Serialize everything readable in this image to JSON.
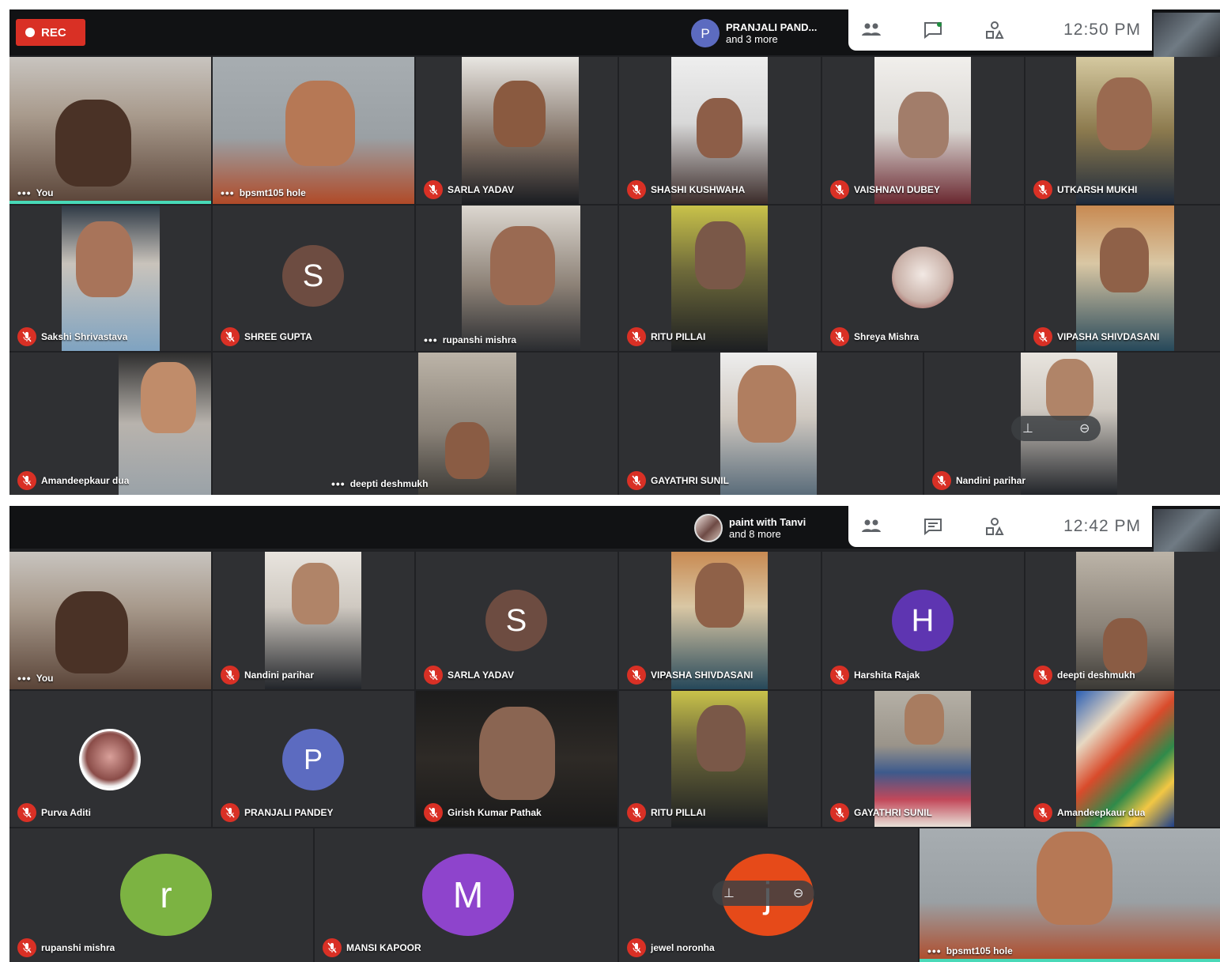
{
  "colors": {
    "background": "#202124",
    "topbar": "#111214",
    "tile": "#3c4043",
    "mic_off": "#d93025",
    "rec": "#d93025",
    "active_speaker": "#48d9b8"
  },
  "screenshot_top": {
    "rec_label": "REC",
    "presenting": {
      "avatar_letter": "P",
      "name": "PRANJALI PAND...",
      "more": "and 3 more"
    },
    "panel": {
      "people_count_icon": "people-icon",
      "chat_icon": "chat-icon",
      "activities_icon": "activities-icon",
      "time": "12:50 PM"
    },
    "tiles": [
      {
        "name": "You",
        "status": "more-options"
      },
      {
        "name": "bpsmt105 hole",
        "status": "more-options"
      },
      {
        "name": "SARLA YADAV",
        "status": "muted"
      },
      {
        "name": "SHASHI KUSHWAHA",
        "status": "muted"
      },
      {
        "name": "VAISHNAVI DUBEY",
        "status": "muted"
      },
      {
        "name": "UTKARSH MUKHI",
        "status": "muted"
      },
      {
        "name": "Sakshi Shrivastava",
        "status": "muted"
      },
      {
        "name": "SHREE GUPTA",
        "status": "muted",
        "avatar_letter": "S"
      },
      {
        "name": "rupanshi mishra",
        "status": "more-options"
      },
      {
        "name": "RITU PILLAI",
        "status": "muted"
      },
      {
        "name": "Shreya Mishra",
        "status": "muted"
      },
      {
        "name": "VIPASHA SHIVDASANI",
        "status": "muted"
      },
      {
        "name": "Amandeepkaur dua",
        "status": "muted"
      },
      {
        "name": "deepti deshmukh",
        "status": "more-options"
      },
      {
        "name": "GAYATHRI SUNIL",
        "status": "muted"
      },
      {
        "name": "Nandini parihar",
        "status": "muted"
      }
    ]
  },
  "screenshot_bottom": {
    "presenting": {
      "name": "paint with Tanvi",
      "more": "and 8 more"
    },
    "panel": {
      "time": "12:42 PM"
    },
    "tiles": [
      {
        "name": "You",
        "status": "more-options"
      },
      {
        "name": "Nandini parihar",
        "status": "muted"
      },
      {
        "name": "SARLA YADAV",
        "status": "muted",
        "avatar_letter": "S"
      },
      {
        "name": "VIPASHA SHIVDASANI",
        "status": "muted"
      },
      {
        "name": "Harshita Rajak",
        "status": "muted",
        "avatar_letter": "H"
      },
      {
        "name": "deepti deshmukh",
        "status": "muted"
      },
      {
        "name": "Purva Aditi",
        "status": "muted"
      },
      {
        "name": "PRANJALI PANDEY",
        "status": "muted",
        "avatar_letter": "P"
      },
      {
        "name": "Girish Kumar Pathak",
        "status": "muted"
      },
      {
        "name": "RITU PILLAI",
        "status": "muted"
      },
      {
        "name": "GAYATHRI SUNIL",
        "status": "muted"
      },
      {
        "name": "Amandeepkaur dua",
        "status": "muted"
      },
      {
        "name": "rupanshi mishra",
        "status": "muted",
        "avatar_letter": "r"
      },
      {
        "name": "MANSI KAPOOR",
        "status": "muted",
        "avatar_letter": "M"
      },
      {
        "name": "jewel noronha",
        "status": "muted",
        "avatar_letter": "j"
      },
      {
        "name": "bpsmt105 hole",
        "status": "more-options"
      }
    ]
  }
}
